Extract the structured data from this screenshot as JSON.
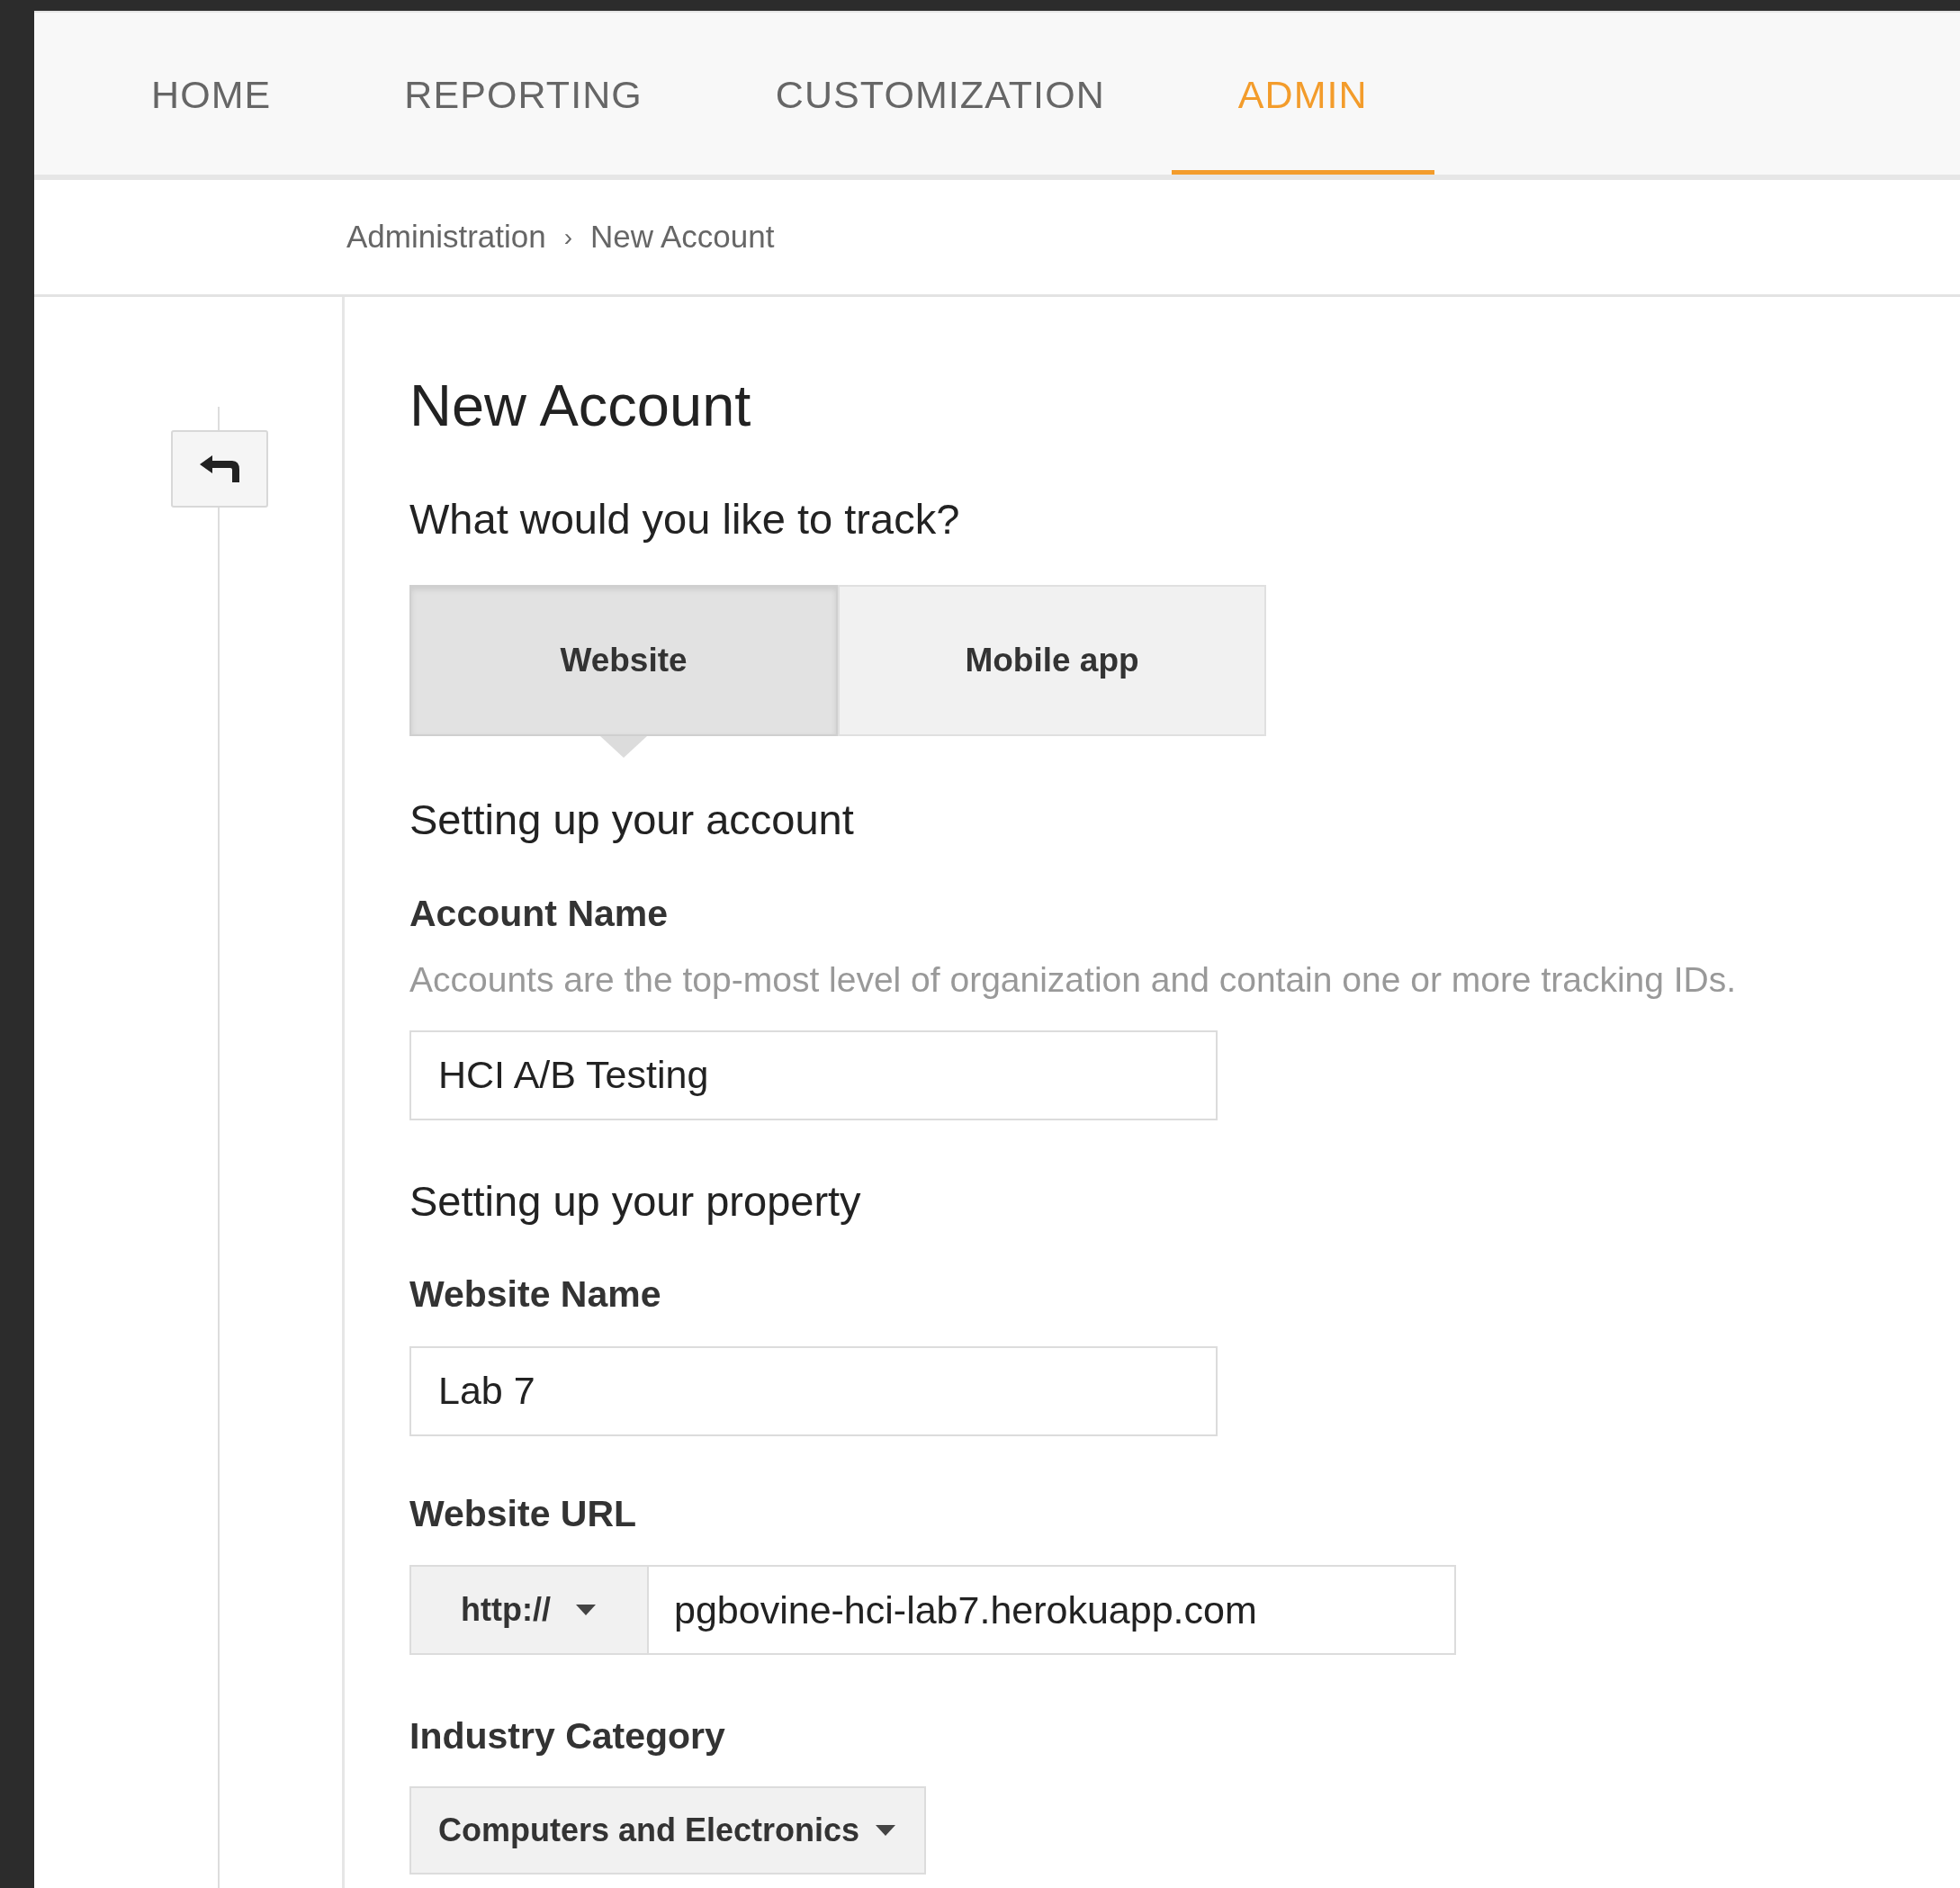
{
  "nav_tabs": [
    {
      "label": "HOME",
      "selected": false
    },
    {
      "label": "REPORTING",
      "selected": false
    },
    {
      "label": "CUSTOMIZATION",
      "selected": false
    },
    {
      "label": "ADMIN",
      "selected": true
    }
  ],
  "breadcrumb": {
    "items": [
      "Administration",
      "New Account"
    ],
    "separator": "›"
  },
  "page_title": "New Account",
  "track_question": "What would you like to track?",
  "track_options": [
    {
      "label": "Website",
      "selected": true
    },
    {
      "label": "Mobile app",
      "selected": false
    }
  ],
  "account_section": {
    "heading": "Setting up your account",
    "label": "Account Name",
    "description": "Accounts are the top-most level of organization and contain one or more tracking IDs.",
    "value": "HCI A/B Testing"
  },
  "property_section": {
    "heading": "Setting up your property",
    "website_name": {
      "label": "Website Name",
      "value": "Lab 7"
    },
    "website_url": {
      "label": "Website URL",
      "protocol": "http://",
      "value": "pgbovine-hci-lab7.herokuapp.com"
    },
    "industry_category": {
      "label": "Industry Category",
      "value": "Computers and Electronics"
    }
  }
}
